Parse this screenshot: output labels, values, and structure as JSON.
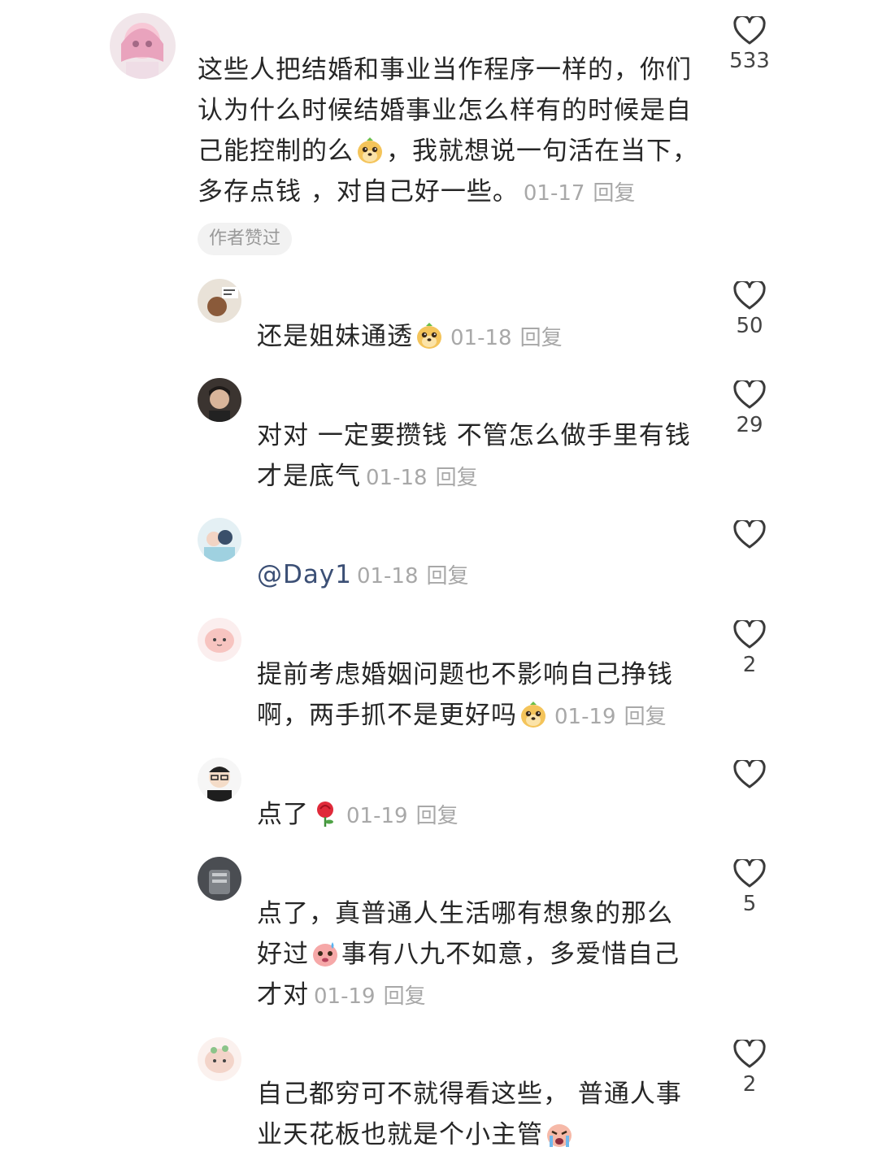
{
  "comments": [
    {
      "username": "",
      "text": "这些人把结婚和事业当作程序一样的，你们认为什么时候结婚事业怎么样有的时候是自己能控制的么",
      "text2": "，我就想说一句活在当下，多存点钱 ，对自己好一些。",
      "date": "01-17",
      "reply": "回复",
      "likes": "533",
      "badge": "作者赞过",
      "emoji": "dog-face-emoji"
    },
    {
      "text": "还是姐妹通透",
      "date": "01-18",
      "reply": "回复",
      "likes": "50",
      "emoji": "dog-face-emoji"
    },
    {
      "text": "对对 一定要攒钱 不管怎么做手里有钱才是底气",
      "date": "01-18",
      "reply": "回复",
      "likes": "29"
    },
    {
      "mention": "@Day1",
      "date": "01-18",
      "reply": "回复",
      "likes": ""
    },
    {
      "text": "提前考虑婚姻问题也不影响自己挣钱啊，两手抓不是更好吗",
      "date": "01-19",
      "reply": "回复",
      "likes": "2",
      "emoji": "dog-face-emoji"
    },
    {
      "text": "点了",
      "date": "01-19",
      "reply": "回复",
      "likes": "",
      "emoji": "rose-emoji"
    },
    {
      "text": "点了，真普通人生活哪有想象的那么好过",
      "text2": "事有八九不如意，多爱惜自己才对",
      "date": "01-19",
      "reply": "回复",
      "likes": "5",
      "emoji": "sweat-face-emoji"
    },
    {
      "text": "自己都穷可不就得看这些， 普通人事业天花板也就是个小主管",
      "likes": "2",
      "emoji": "crying-face-emoji"
    }
  ],
  "colors": {
    "text": "#262626",
    "meta": "#a8a8a8",
    "mention": "#3b4f75",
    "heart": "#3a3a3a"
  }
}
